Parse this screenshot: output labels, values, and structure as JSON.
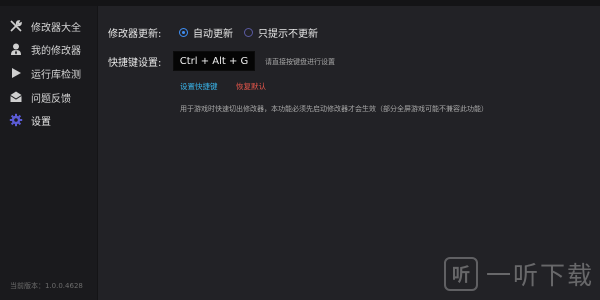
{
  "sidebar": {
    "items": [
      {
        "label": "修改器大全",
        "icon": "wrench-screwdriver-icon"
      },
      {
        "label": "我的修改器",
        "icon": "user-tie-icon"
      },
      {
        "label": "运行库检测",
        "icon": "play-icon"
      },
      {
        "label": "问题反馈",
        "icon": "envelope-icon"
      },
      {
        "label": "设置",
        "icon": "gear-icon",
        "active": true
      }
    ],
    "version": "当前版本：1.0.0.4628"
  },
  "settings": {
    "update_label": "修改器更新:",
    "update_options": [
      "自动更新",
      "只提示不更新"
    ],
    "update_selected": "自动更新",
    "hotkey_label": "快捷键设置:",
    "hotkey_value": "Ctrl + Alt + G",
    "hotkey_hint": "请直接按键盘进行设置",
    "set_hotkey_link": "设置快捷键",
    "reset_link": "恢复默认",
    "description": "用于游戏时快速切出修改器，本功能必须先启动修改器才会生效（部分全屏游戏可能不兼容此功能）"
  },
  "colors": {
    "accent_blue": "#3f8ef2",
    "link_blue": "#39b3e8",
    "link_red": "#e8574b",
    "active_icon": "#5b5bd6"
  },
  "watermark": {
    "logo_char": "听",
    "text": "一听下载"
  }
}
